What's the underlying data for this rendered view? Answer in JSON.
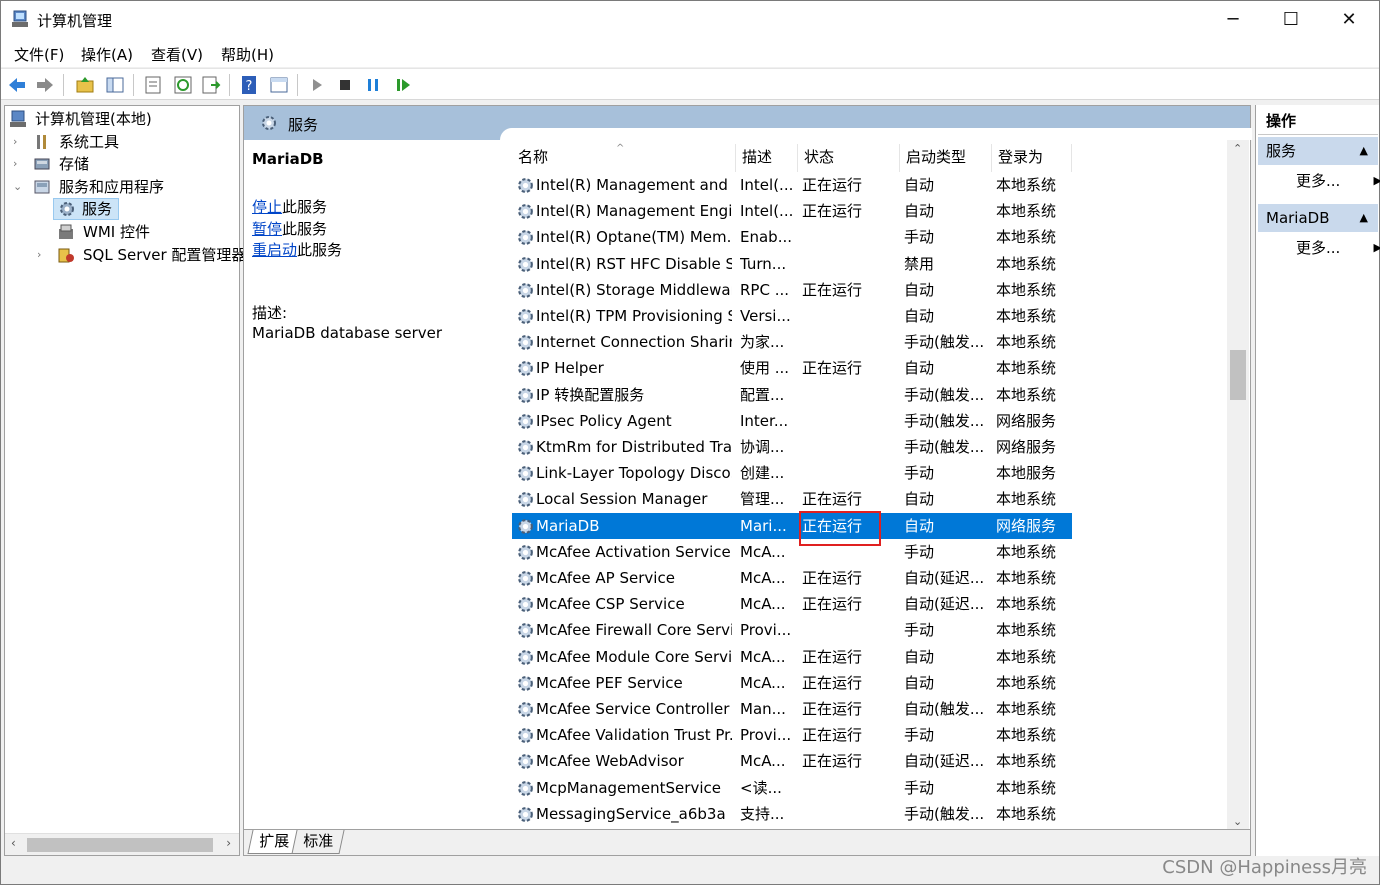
{
  "window": {
    "title": "计算机管理"
  },
  "menubar": [
    "文件(F)",
    "操作(A)",
    "查看(V)",
    "帮助(H)"
  ],
  "tree": {
    "root": "计算机管理(本地)",
    "items": [
      {
        "label": "系统工具",
        "icon": "tools-icon"
      },
      {
        "label": "存储",
        "icon": "storage-icon"
      },
      {
        "label": "服务和应用程序",
        "icon": "services-apps-icon"
      },
      {
        "label": "服务",
        "icon": "services-icon",
        "selected": true
      },
      {
        "label": "WMI 控件",
        "icon": "wmi-icon"
      },
      {
        "label": "SQL Server 配置管理器",
        "icon": "sqlserver-icon"
      }
    ]
  },
  "services_panel": {
    "header": "服务",
    "selected_name": "MariaDB",
    "stop_link": "停止",
    "stop_text": "此服务",
    "pause_link": "暂停",
    "pause_text": "此服务",
    "restart_link": "重启动",
    "restart_text": "此服务",
    "desc_label": "描述:",
    "desc_value": "MariaDB database server"
  },
  "table": {
    "columns": [
      "名称",
      "描述",
      "状态",
      "启动类型",
      "登录为"
    ],
    "rows": [
      [
        "Intel(R) Management and ...",
        "Intel(...",
        "正在运行",
        "自动",
        "本地系统"
      ],
      [
        "Intel(R) Management Engi...",
        "Intel(...",
        "正在运行",
        "自动",
        "本地系统"
      ],
      [
        "Intel(R) Optane(TM) Mem...",
        "Enab...",
        "",
        "手动",
        "本地系统"
      ],
      [
        "Intel(R) RST HFC Disable S...",
        "Turn...",
        "",
        "禁用",
        "本地系统"
      ],
      [
        "Intel(R) Storage Middlewar...",
        "RPC ...",
        "正在运行",
        "自动",
        "本地系统"
      ],
      [
        "Intel(R) TPM Provisioning S...",
        "Versi...",
        "",
        "自动",
        "本地系统"
      ],
      [
        "Internet Connection Sharin...",
        "为家...",
        "",
        "手动(触发...",
        "本地系统"
      ],
      [
        "IP Helper",
        "使用 ...",
        "正在运行",
        "自动",
        "本地系统"
      ],
      [
        "IP 转换配置服务",
        "配置...",
        "",
        "手动(触发...",
        "本地系统"
      ],
      [
        "IPsec Policy Agent",
        "Inter...",
        "",
        "手动(触发...",
        "网络服务"
      ],
      [
        "KtmRm for Distributed Tra...",
        "协调...",
        "",
        "手动(触发...",
        "网络服务"
      ],
      [
        "Link-Layer Topology Disco...",
        "创建...",
        "",
        "手动",
        "本地服务"
      ],
      [
        "Local Session Manager",
        "管理...",
        "正在运行",
        "自动",
        "本地系统"
      ],
      [
        "MariaDB",
        "Mari...",
        "正在运行",
        "自动",
        "网络服务"
      ],
      [
        "McAfee Activation Service",
        "McA...",
        "",
        "手动",
        "本地系统"
      ],
      [
        "McAfee AP Service",
        "McA...",
        "正在运行",
        "自动(延迟...",
        "本地系统"
      ],
      [
        "McAfee CSP Service",
        "McA...",
        "正在运行",
        "自动(延迟...",
        "本地系统"
      ],
      [
        "McAfee Firewall Core Servi...",
        "Provi...",
        "",
        "手动",
        "本地系统"
      ],
      [
        "McAfee Module Core Servi...",
        "McA...",
        "正在运行",
        "自动",
        "本地系统"
      ],
      [
        "McAfee PEF Service",
        "McA...",
        "正在运行",
        "自动",
        "本地系统"
      ],
      [
        "McAfee Service Controller",
        "Man...",
        "正在运行",
        "自动(触发...",
        "本地系统"
      ],
      [
        "McAfee Validation Trust Pr...",
        "Provi...",
        "正在运行",
        "手动",
        "本地系统"
      ],
      [
        "McAfee WebAdvisor",
        "McA...",
        "正在运行",
        "自动(延迟...",
        "本地系统"
      ],
      [
        "McpManagementService",
        "<读...",
        "",
        "手动",
        "本地系统"
      ],
      [
        "MessagingService_a6b3a",
        "支持...",
        "",
        "手动(触发...",
        "本地系统"
      ]
    ],
    "selected_index": 13
  },
  "bottom_tabs": [
    "扩展",
    "标准"
  ],
  "actions": {
    "title": "操作",
    "sections": [
      {
        "header": "服务",
        "more": "更多..."
      },
      {
        "header": "MariaDB",
        "more": "更多..."
      }
    ]
  },
  "watermark": "CSDN @Happiness月亮",
  "colors": {
    "selection": "#0078d7",
    "panel_header": "#a7c0da",
    "highlight_box": "#e02020",
    "link": "#0045c8"
  }
}
